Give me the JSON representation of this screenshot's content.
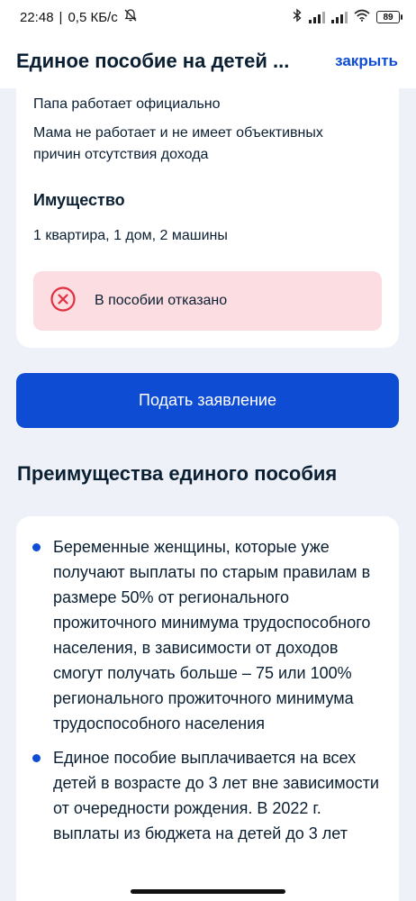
{
  "status_bar": {
    "time": "22:48",
    "net_speed": "0,5 КБ/с",
    "battery": "89"
  },
  "header": {
    "title": "Единое пособие на детей ...",
    "close_label": "закрыть"
  },
  "details": {
    "father_status": "Папа работает официально",
    "mother_status_line1": "Мама не работает и не имеет объективных",
    "mother_status_line2": "причин отсутствия дохода",
    "property_heading": "Имущество",
    "property_value": "1 квартира, 1 дом, 2 машины",
    "alert_text": "В пособии отказано",
    "alert_icon": "cross-circle-icon",
    "alert_color": "#fcdde1"
  },
  "submit_button": {
    "label": "Подать заявление",
    "color": "#0d4cd3"
  },
  "benefits": {
    "title": "Преимущества единого пособия",
    "items": [
      "Беременные женщины, которые уже получают выплаты по старым правилам в размере 50% от регионального прожиточного минимума трудоспособного населения, в зависимости от доходов смогут получать больше – 75 или 100% регионального прожиточного минимума трудоспособного населения",
      "Единое пособие выплачивается на всех детей в возрасте до 3 лет вне зависимости от очередности рождения. В 2022 г. выплаты из бюджета на детей до 3 лет"
    ]
  }
}
